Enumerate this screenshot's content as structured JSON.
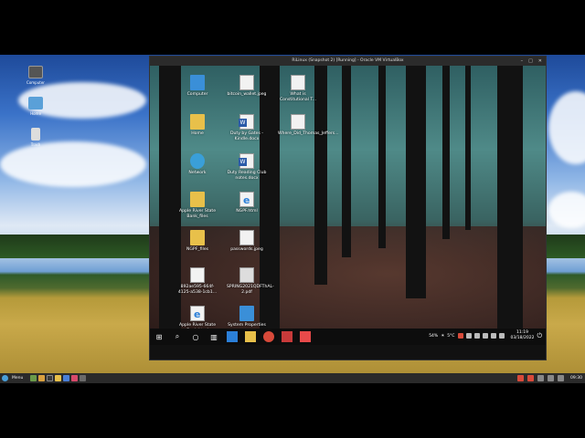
{
  "host": {
    "desktop_icons": [
      {
        "label": "Computer",
        "icon": "monitor-icon"
      },
      {
        "label": "Home",
        "icon": "home-folder-icon"
      },
      {
        "label": "Trash",
        "icon": "trash-icon"
      }
    ],
    "panel": {
      "menu_label": "Menu",
      "clock": "09:30"
    }
  },
  "vm": {
    "title": "RiLinux (Snapshot 2) [Running] - Oracle VM VirtualBox",
    "guest": {
      "icons": [
        {
          "label": "Computer",
          "icon": "computer-icon",
          "kind": "pc"
        },
        {
          "label": "bitcoin_wallet.jpeg",
          "icon": "image-file-icon",
          "kind": "doc"
        },
        {
          "label": "What is Constitutional T...",
          "icon": "document-icon",
          "kind": "doc"
        },
        {
          "label": "Home",
          "icon": "home-folder-icon",
          "kind": "folder"
        },
        {
          "label": "Duty by Gates - Kindle.docx",
          "icon": "word-document-icon",
          "kind": "word"
        },
        {
          "label": "Where_Did_Thomas_Jeffers...",
          "icon": "document-icon",
          "kind": "doc"
        },
        {
          "label": "Network",
          "icon": "network-icon",
          "kind": "net"
        },
        {
          "label": "Duty Reading Club notes.docx",
          "icon": "word-document-icon",
          "kind": "word"
        },
        {
          "label": "Apple River State Bank_files",
          "icon": "folder-icon",
          "kind": "folder"
        },
        {
          "label": "NGPF.html",
          "icon": "html-file-icon",
          "kind": "ie"
        },
        {
          "label": "NGPF_files",
          "icon": "folder-icon",
          "kind": "folder"
        },
        {
          "label": "passwords.jpeg",
          "icon": "image-file-icon",
          "kind": "doc"
        },
        {
          "label": "892ae595-664f-4125-a538-1cb1...",
          "icon": "document-icon",
          "kind": "doc"
        },
        {
          "label": "SPRING2021QDFThAL-2.pdf",
          "icon": "pdf-file-icon",
          "kind": "pdf"
        },
        {
          "label": "Apple River State Bank.html",
          "icon": "html-file-icon",
          "kind": "ie"
        },
        {
          "label": "System Properties",
          "icon": "system-properties-icon",
          "kind": "pc"
        }
      ],
      "taskbar": {
        "battery": "54%",
        "temperature": "5°C",
        "time": "11:19",
        "date": "03/18/2022"
      }
    }
  }
}
